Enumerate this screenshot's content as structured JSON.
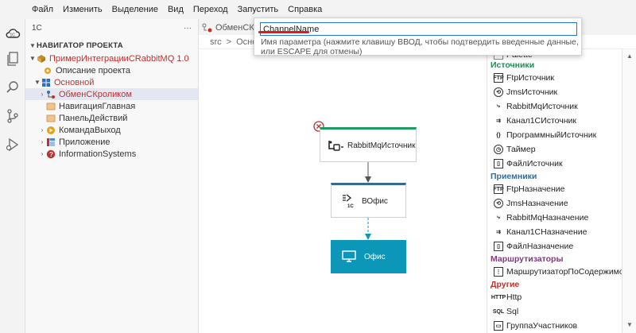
{
  "menu": [
    "Файл",
    "Изменить",
    "Выделение",
    "Вид",
    "Переход",
    "Запустить",
    "Справка"
  ],
  "sidebar": {
    "header": "1С",
    "more": "···",
    "section": "НАВИГАТОР ПРОЕКТА",
    "project": "ПримерИнтеграцииCRabbitMQ 1.0",
    "description": "Описание проекта",
    "module": "Основной",
    "items": [
      {
        "label": "ОбменСКроликом"
      },
      {
        "label": "НавигацияГлавная"
      },
      {
        "label": "ПанельДействий"
      },
      {
        "label": "КомандаВыход"
      },
      {
        "label": "Приложение"
      },
      {
        "label": "InformationSystems"
      }
    ]
  },
  "editor": {
    "tab": "ОбменСКро",
    "breadcrumb_src": "src",
    "breadcrumb_sep": ">",
    "breadcrumb_item": "Основ"
  },
  "popup": {
    "value": "ChannelName",
    "hint": "Имя параметра (нажмите клавишу ВВОД, чтобы подтвердить введенные данные, или ESCAPE для отмены)"
  },
  "diagram": {
    "source": "RabbitMqИсточник",
    "target": "ВОфис",
    "target_badge": "1С",
    "office": "Офис"
  },
  "palette": {
    "top_item": "Palette",
    "groups": [
      {
        "name": "Источники",
        "color": "#1f8a55",
        "items": [
          "FtpИсточник",
          "JmsИсточник",
          "RabbitMqИсточник",
          "Канал1СИсточник",
          "ПрограммныйИсточник",
          "Таймер",
          "ФайлИсточник"
        ]
      },
      {
        "name": "Приемники",
        "color": "#336b94",
        "items": [
          "FtpНазначение",
          "JmsНазначение",
          "RabbitMqНазначение",
          "Канал1СНазначение",
          "ФайлНазначение"
        ]
      },
      {
        "name": "Маршрутизаторы",
        "color": "#7a3b7a",
        "items": [
          "МаршрутизаторПоСодержимому"
        ]
      },
      {
        "name": "Другие",
        "color": "#c0302d",
        "items": [
          "Http",
          "Sql",
          "ГруппаУчастников"
        ]
      }
    ]
  },
  "colors": {
    "accent": "#1e77d3",
    "error": "#c0302d",
    "office": "#0c96b8",
    "sources": "#1f9a63",
    "receivers": "#336b94"
  }
}
